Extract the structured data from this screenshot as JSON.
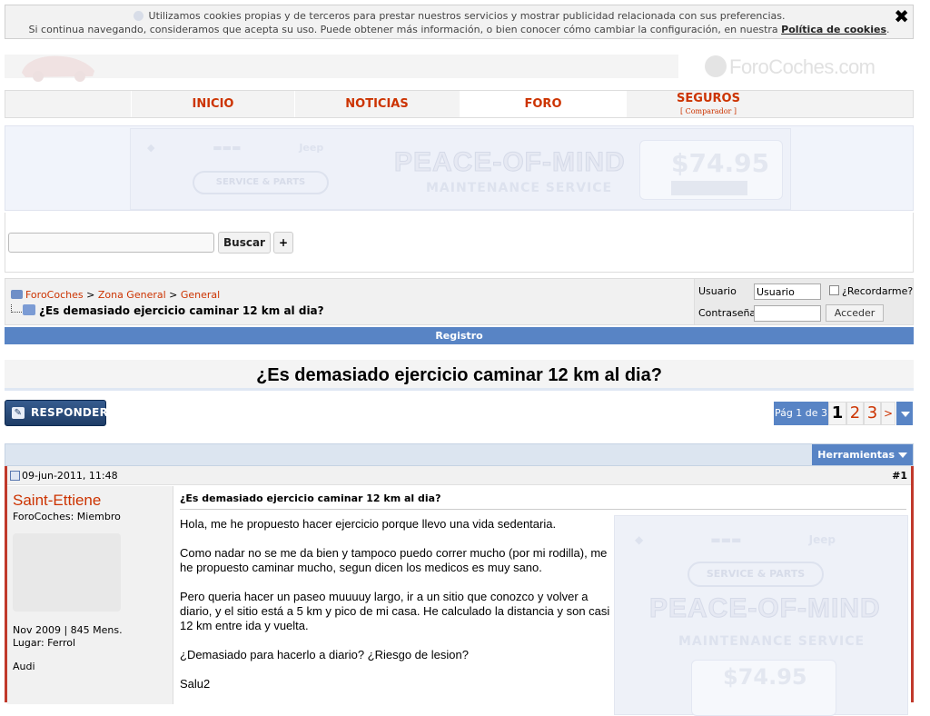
{
  "cookie": {
    "line1": "Utilizamos cookies propias y de terceros para prestar nuestros servicios y mostrar publicidad relacionada con sus preferencias.",
    "line2": "Si continua navegando, consideramos que acepta su uso. Puede obtener más información, o bien conocer cómo cambiar la configuración, en nuestra",
    "policy_link": "Política de cookies",
    "close": "✖"
  },
  "site": {
    "logo_text": "ForoCoches.com"
  },
  "nav": {
    "items": [
      {
        "label": "INICIO"
      },
      {
        "label": "NOTICIAS"
      },
      {
        "label": "FORO"
      },
      {
        "label": "SEGUROS",
        "sub": "[ Comparador ]"
      }
    ]
  },
  "ad": {
    "headline": "PEACE-OF-MIND",
    "sub": "MAINTENANCE SERVICE",
    "brand": "SERVICE & PARTS",
    "price": "$74.95",
    "jeep": "Jeep"
  },
  "search": {
    "button": "Buscar",
    "plus": "+"
  },
  "breadcrumb": {
    "home": "ForoCoches",
    "zona": "Zona General",
    "general": "General",
    "thread": "¿Es demasiado ejercicio caminar 12 km al dia?"
  },
  "login": {
    "user_label": "Usuario",
    "user_value": "Usuario",
    "remember": "¿Recordarme?",
    "pass_label": "Contraseña",
    "submit": "Acceder"
  },
  "registro": "Registro",
  "thread_title": "¿Es demasiado ejercicio caminar 12 km al dia?",
  "responder": "RESPONDER",
  "pager": {
    "label": "Pág 1 de 3",
    "pages": [
      "1",
      "2",
      "3"
    ],
    "next": ">",
    "current_page": 1
  },
  "toolbar": {
    "tools": "Herramientas"
  },
  "post": {
    "date": "09-jun-2011, 11:48",
    "number": "#1",
    "user": {
      "name": "Saint-Ettiene",
      "rank": "ForoCoches: Miembro",
      "reg": "Nov 2009 | 845 Mens.",
      "location": "Lugar: Ferrol",
      "car": "Audi"
    },
    "title": "¿Es demasiado ejercicio caminar 12 km al dia?",
    "paragraphs": [
      "Hola, me he propuesto hacer ejercicio porque llevo una vida sedentaria.",
      "Como nadar no se me da bien y tampoco puedo correr mucho (por mi rodilla), me he propuesto caminar mucho, segun dicen los medicos es muy sano.",
      "Pero queria hacer un paseo muuuuy largo, ir a un sitio que conozco y volver a diario, y el sitio está a 5 km y pico de mi casa. He calculado la distancia y son casi 12 km entre ida y vuelta.",
      "¿Demasiado para hacerlo a diario? ¿Riesgo de lesion?",
      "Salu2"
    ]
  }
}
